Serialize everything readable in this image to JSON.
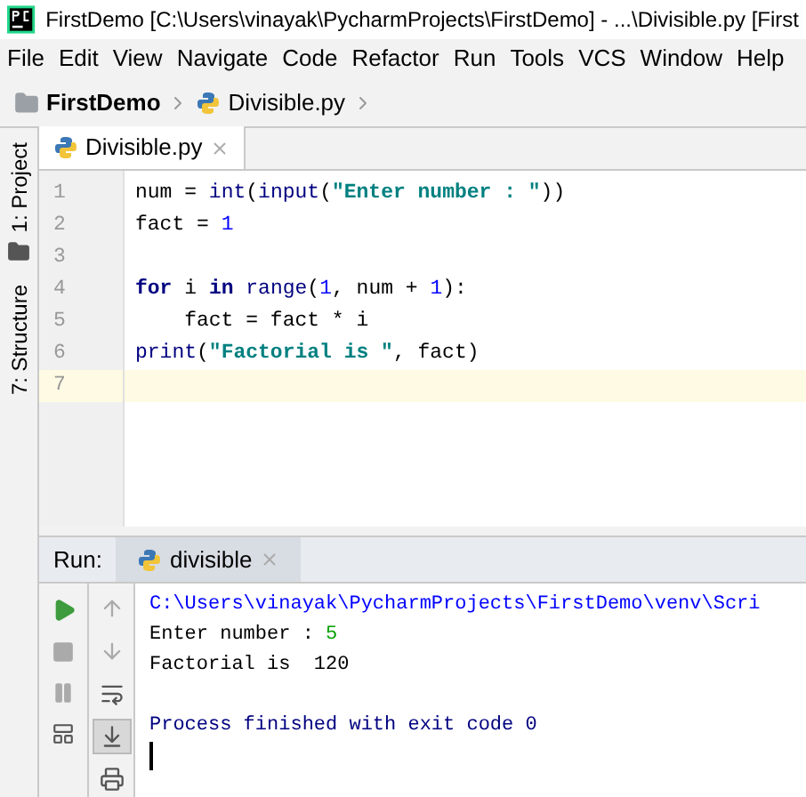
{
  "window": {
    "title": "FirstDemo [C:\\Users\\vinayak\\PycharmProjects\\FirstDemo] - ...\\Divisible.py [First"
  },
  "menu": [
    "File",
    "Edit",
    "View",
    "Navigate",
    "Code",
    "Refactor",
    "Run",
    "Tools",
    "VCS",
    "Window",
    "Help"
  ],
  "breadcrumb": [
    {
      "kind": "folder",
      "label": "FirstDemo"
    },
    {
      "kind": "python",
      "label": "Divisible.py"
    }
  ],
  "side_tabs": [
    {
      "label": "1: Project"
    },
    {
      "label": "7: Structure"
    }
  ],
  "editor_tabs": [
    {
      "label": "Divisible.py",
      "selected": true
    }
  ],
  "code": [
    {
      "number": "1",
      "current": false,
      "tokens": [
        {
          "kind": "plain",
          "text": "num = "
        },
        {
          "kind": "builtin",
          "text": "int"
        },
        {
          "kind": "plain",
          "text": "("
        },
        {
          "kind": "builtin",
          "text": "input"
        },
        {
          "kind": "plain",
          "text": "("
        },
        {
          "kind": "string",
          "text": "\"Enter number : \""
        },
        {
          "kind": "plain",
          "text": "))"
        }
      ]
    },
    {
      "number": "2",
      "current": false,
      "tokens": [
        {
          "kind": "plain",
          "text": "fact = "
        },
        {
          "kind": "number",
          "text": "1"
        }
      ]
    },
    {
      "number": "3",
      "current": false
    },
    {
      "number": "4",
      "current": false,
      "tokens": [
        {
          "kind": "keyword",
          "text": "for"
        },
        {
          "kind": "plain",
          "text": " i "
        },
        {
          "kind": "keyword",
          "text": "in"
        },
        {
          "kind": "builtin",
          "text": " range"
        },
        {
          "kind": "plain",
          "text": "("
        },
        {
          "kind": "number",
          "text": "1"
        },
        {
          "kind": "plain",
          "text": ", num + "
        },
        {
          "kind": "number",
          "text": "1"
        },
        {
          "kind": "plain",
          "text": "):"
        }
      ]
    },
    {
      "number": "5",
      "current": false,
      "tokens": [
        {
          "kind": "plain",
          "text": "    fact = fact * i"
        }
      ]
    },
    {
      "number": "6",
      "current": false,
      "tokens": [
        {
          "kind": "builtin",
          "text": "print"
        },
        {
          "kind": "plain",
          "text": "("
        },
        {
          "kind": "string",
          "text": "\"Factorial is \""
        },
        {
          "kind": "plain",
          "text": ", fact)"
        }
      ]
    },
    {
      "number": "7",
      "current": true
    }
  ],
  "run_panel": {
    "label": "Run:",
    "tabs": [
      {
        "label": "divisible",
        "selected": true
      }
    ]
  },
  "console": [
    {
      "tokens": [
        {
          "kind": "command",
          "text": "C:\\Users\\vinayak\\PycharmProjects\\FirstDemo\\venv\\Scri"
        }
      ]
    },
    {
      "tokens": [
        {
          "kind": "output",
          "text": "Enter number : "
        },
        {
          "kind": "input",
          "text": "5"
        }
      ]
    },
    {
      "tokens": [
        {
          "kind": "output",
          "text": "Factorial is  120"
        }
      ]
    },
    {
      "kind": "exit",
      "tokens": [
        {
          "kind": "system",
          "text": "Process finished with exit code 0"
        }
      ]
    }
  ],
  "run_tools": [
    {
      "kind": "up",
      "selected": false
    },
    {
      "kind": "down",
      "selected": false
    },
    {
      "kind": "wrap",
      "selected": false
    },
    {
      "kind": "scroll-end",
      "selected": true
    },
    {
      "kind": "print",
      "selected": false
    }
  ]
}
